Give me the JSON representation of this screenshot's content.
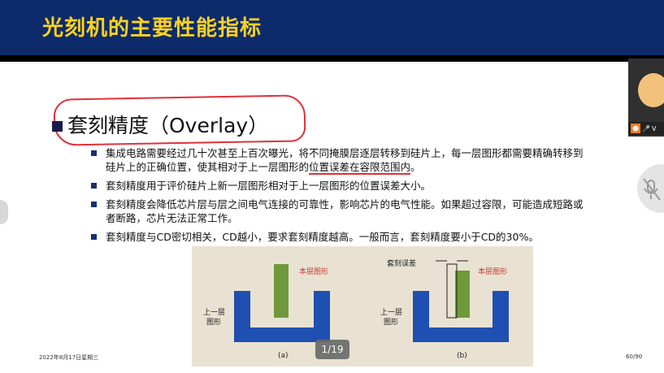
{
  "slide": {
    "title": "光刻机的主要性能指标",
    "heading": "套刻精度（Overlay）",
    "bullets": [
      {
        "pre": "集成电路需要经过几十次甚至上百次曝光，将不同掩膜层逐层转移到硅片上，每一层图形都需要精确转移到硅片上的正确位置，使其相对于上一层图形的",
        "ul": "位置误差在容限范围内",
        "post": "。"
      },
      {
        "pre": "套刻精度用于评价硅片上新一层图形相对于上一层图形的位置误差大小。",
        "ul": "",
        "post": ""
      },
      {
        "pre": "套刻精度会降低芯片层与层之间电气连接的可靠性，影响芯片的电气性能。如果超过容限，可能造成短路或者断路，芯片无法正常工作。",
        "ul": "",
        "post": ""
      },
      {
        "pre": "套刻精度与CD密切相关，CD越小，要求套刻精度越高。一般而言，套刻精度要小于CD的30%。",
        "ul": "",
        "post": ""
      }
    ],
    "figure": {
      "a": {
        "current_layer": "本层图形",
        "prev_layer_1": "上一层",
        "prev_layer_2": "图形",
        "caption": "(a)"
      },
      "b": {
        "overlay_error": "套刻误差",
        "current_layer": "本层图形",
        "prev_layer_1": "上一层",
        "prev_layer_2": "图形",
        "caption": "(b)"
      }
    },
    "footer_date": "2022年8月17日星期三",
    "footer_page": "60/90"
  },
  "viewer": {
    "pager": "1/19",
    "participant_initial": "V"
  },
  "colors": {
    "title_bg": "#0d2b6b",
    "title_fg": "#ffd21f",
    "annotation": "#e0303a",
    "blue_shape": "#1f4fb0",
    "green_shape": "#6f9a3a"
  },
  "icons": [
    "user-icon",
    "microphone-icon",
    "microphone-muted-icon"
  ]
}
